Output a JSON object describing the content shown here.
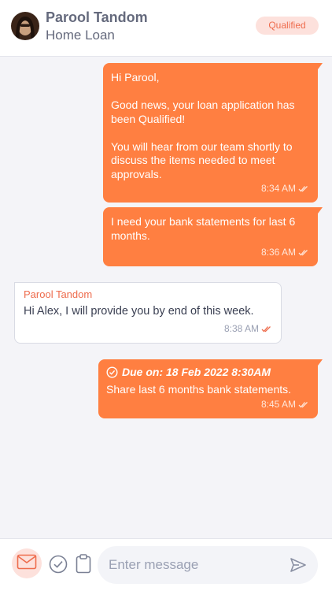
{
  "header": {
    "contact_name": "Parool Tandom",
    "contact_subtitle": "Home Loan",
    "status_badge": "Qualified"
  },
  "messages": [
    {
      "direction": "outgoing",
      "text": "Hi Parool,\n\nGood news, your loan application has been Qualified!\n\nYou will hear from our team shortly to discuss the items needed to meet approvals.",
      "time": "8:34 AM",
      "status_icon": "double-check-icon"
    },
    {
      "direction": "outgoing",
      "text": "I need your bank statements for last 6 months.",
      "time": "8:36 AM",
      "status_icon": "double-check-icon"
    },
    {
      "direction": "incoming",
      "sender": "Parool Tandom",
      "text": "Hi Alex, I will provide you by end of this week.",
      "time": "8:38 AM",
      "status_icon": "double-check-icon"
    },
    {
      "direction": "outgoing",
      "due_label": "Due on: 18 Feb 2022 8:30AM",
      "text": "Share last 6 months bank statements.",
      "time": "8:45 AM",
      "status_icon": "double-check-icon"
    }
  ],
  "composer": {
    "placeholder": "Enter message",
    "icons": [
      "mail-icon",
      "check-circle-icon",
      "clipboard-icon",
      "send-icon"
    ]
  },
  "colors": {
    "accent": "#ff7f41",
    "accent_soft": "#fde1dc",
    "badge_text": "#ee6c4d",
    "background": "#f4f4f8"
  }
}
